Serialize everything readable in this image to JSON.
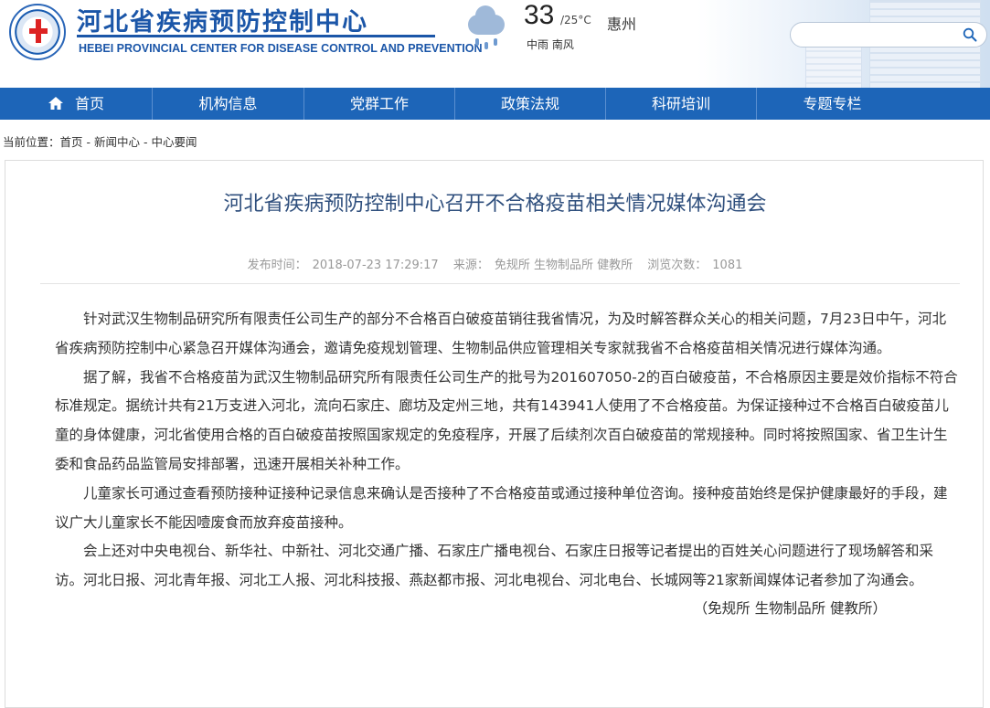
{
  "header": {
    "site_title_cn": "河北省疾病预防控制中心",
    "site_title_en": "HEBEI PROVINCIAL CENTER FOR DISEASE CONTROL AND PREVENTION",
    "logo_icon": "hebei-cdc-logo",
    "weather": {
      "temperature": "33",
      "temp_range": "/25°C",
      "city": "惠州",
      "description": "中雨 南风",
      "icon": "rain-cloud-icon"
    },
    "search": {
      "placeholder": "",
      "value": "",
      "icon": "search-icon"
    }
  },
  "nav": {
    "items": [
      {
        "label": "首页",
        "icon": "home-icon"
      },
      {
        "label": "机构信息"
      },
      {
        "label": "党群工作"
      },
      {
        "label": "政策法规"
      },
      {
        "label": "科研培训"
      },
      {
        "label": "专题专栏"
      }
    ],
    "bg_color": "#1d65b8"
  },
  "breadcrumb": {
    "prefix": "当前位置：",
    "items": [
      "首页",
      "新闻中心",
      "中心要闻"
    ],
    "separator": " - "
  },
  "article": {
    "title": "河北省疾病预防控制中心召开不合格疫苗相关情况媒体沟通会",
    "meta": {
      "publish_label": "发布时间：",
      "publish_time": "2018-07-23 17:29:17",
      "source_label": "来源：",
      "source": "免规所 生物制品所 健教所",
      "views_label": "浏览次数：",
      "views": "1081"
    },
    "lines": [
      "　　针对武汉生物制品研究所有限责任公司生产的部分不合格百白破疫苗销往我省情况，为及时解答群众关心的相关问题，7月23日中午，河北",
      "省疾病预防控制中心紧急召开媒体沟通会，邀请免疫规划管理、生物制品供应管理相关专家就我省不合格疫苗相关情况进行媒体沟通。",
      "　　据了解，我省不合格疫苗为武汉生物制品研究所有限责任公司生产的批号为201607050-2的百白破疫苗，不合格原因主要是效价指标不符合",
      "标准规定。据统计共有21万支进入河北，流向石家庄、廊坊及定州三地，共有143941人使用了不合格疫苗。为保证接种过不合格百白破疫苗儿",
      "童的身体健康，河北省使用合格的百白破疫苗按照国家规定的免疫程序，开展了后续剂次百白破疫苗的常规接种。同时将按照国家、省卫生计生",
      "委和食品药品监管局安排部署，迅速开展相关补种工作。",
      "　　儿童家长可通过查看预防接种证接种记录信息来确认是否接种了不合格疫苗或通过接种单位咨询。接种疫苗始终是保护健康最好的手段，建",
      "议广大儿童家长不能因噎废食而放弃疫苗接种。",
      "　　会上还对中央电视台、新华社、中新社、河北交通广播、石家庄广播电视台、石家庄日报等记者提出的百姓关心问题进行了现场解答和采",
      "访。河北日报、河北青年报、河北工人报、河北科技报、燕赵都市报、河北电视台、河北电台、长城网等21家新闻媒体记者参加了沟通会。"
    ],
    "signature": "（免规所 生物制品所 健教所）"
  }
}
